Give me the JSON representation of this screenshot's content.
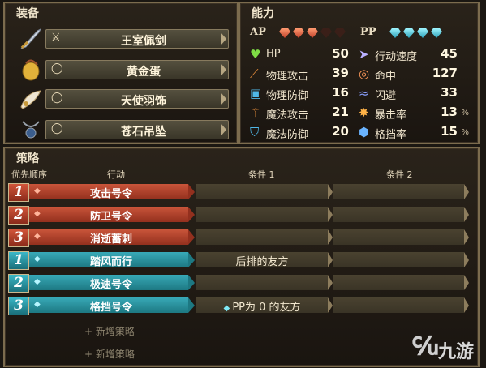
{
  "equipment": {
    "title": "装备",
    "items": [
      {
        "type_icon": "sword-type-icon",
        "type_glyph": "⚔",
        "name": "王室佩剑",
        "icon": "sword-icon"
      },
      {
        "type_icon": "ring-type-icon",
        "type_glyph": "◯",
        "name": "黄金蛋",
        "icon": "golden-egg-icon"
      },
      {
        "type_icon": "ring-type-icon",
        "type_glyph": "◯",
        "name": "天使羽饰",
        "icon": "feather-icon"
      },
      {
        "type_icon": "ring-type-icon",
        "type_glyph": "◯",
        "name": "苍石吊坠",
        "icon": "pendant-icon"
      }
    ]
  },
  "abilities": {
    "title": "能力",
    "ap_label": "AP",
    "pp_label": "PP",
    "ap_gems": {
      "filled": 3,
      "total": 5
    },
    "pp_gems": {
      "filled": 4,
      "total": 4
    },
    "stats_left": [
      {
        "label": "HP",
        "value": "50",
        "icon": "heart-icon"
      },
      {
        "label": "物理攻击",
        "value": "39",
        "icon": "sword-attack-icon"
      },
      {
        "label": "物理防御",
        "value": "16",
        "icon": "armor-icon"
      },
      {
        "label": "魔法攻击",
        "value": "21",
        "icon": "magic-wand-icon"
      },
      {
        "label": "魔法防御",
        "value": "20",
        "icon": "magic-shield-icon"
      }
    ],
    "stats_right": [
      {
        "label": "行动速度",
        "value": "45",
        "pct": "",
        "icon": "speed-icon"
      },
      {
        "label": "命中",
        "value": "127",
        "pct": "",
        "icon": "target-icon"
      },
      {
        "label": "闪避",
        "value": "33",
        "pct": "",
        "icon": "evade-icon"
      },
      {
        "label": "暴击率",
        "value": "13",
        "pct": "%",
        "icon": "critical-icon"
      },
      {
        "label": "格挡率",
        "value": "15",
        "pct": "%",
        "icon": "block-icon"
      }
    ]
  },
  "strategy": {
    "title": "策略",
    "headers": {
      "priority": "优先顺序",
      "action": "行动",
      "cond1": "条件 1",
      "cond2": "条件 2"
    },
    "rows": [
      {
        "num": "1",
        "kind": "ap",
        "action": "攻击号令",
        "cond1": "",
        "cond2": ""
      },
      {
        "num": "2",
        "kind": "ap",
        "action": "防卫号令",
        "cond1": "",
        "cond2": ""
      },
      {
        "num": "3",
        "kind": "ap",
        "action": "消逝蓄刺",
        "cond1": "",
        "cond2": ""
      },
      {
        "num": "1",
        "kind": "pp",
        "action": "踏风而行",
        "cond1": "后排的友方",
        "cond2": ""
      },
      {
        "num": "2",
        "kind": "pp",
        "action": "极速号令",
        "cond1": "",
        "cond2": ""
      },
      {
        "num": "3",
        "kind": "pp",
        "action": "格挡号令",
        "cond1": "PP为 0 的友方",
        "cond2": ""
      }
    ],
    "add_labels": [
      "+ 新增策略",
      "+ 新增策略"
    ]
  },
  "watermark": "九游",
  "colors": {
    "ap_red": "#b8402a",
    "pp_teal": "#2a9aa6",
    "gold_border": "#7c6c4e",
    "heart_green": "#7fdc45"
  }
}
